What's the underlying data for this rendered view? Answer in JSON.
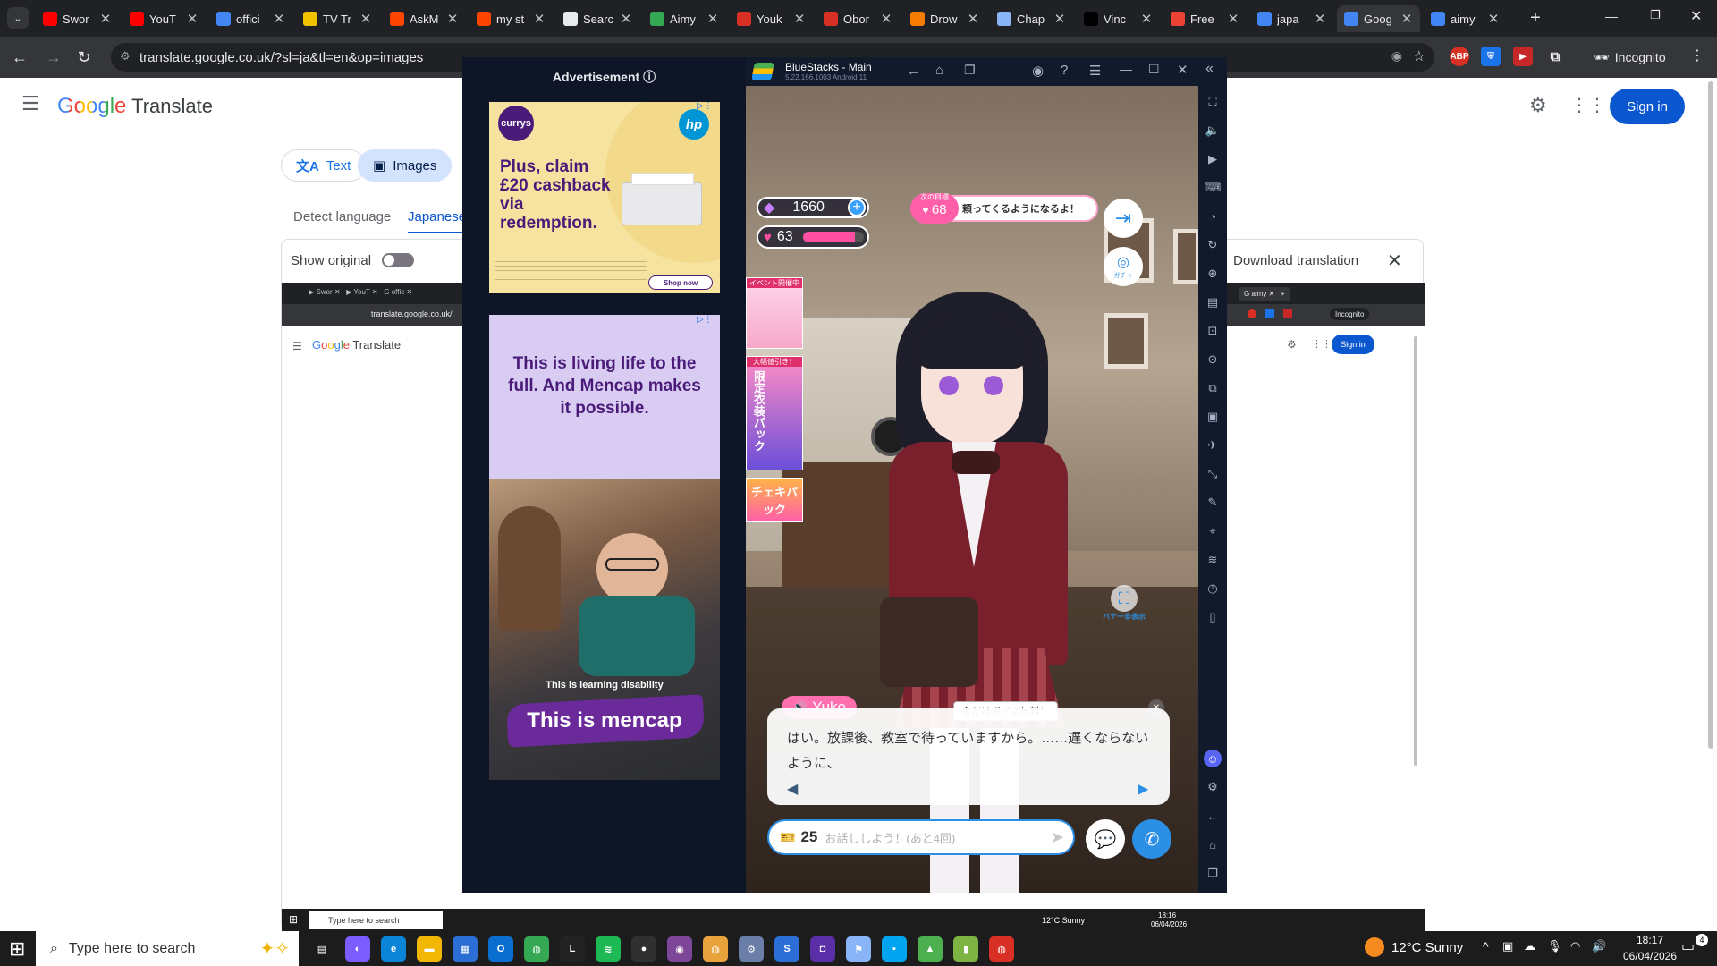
{
  "browser": {
    "tabs": [
      {
        "label": "Swor",
        "fav": "youtube-icon",
        "color": "#ff0000"
      },
      {
        "label": "YouT",
        "fav": "youtube-icon",
        "color": "#ff0000"
      },
      {
        "label": "offici",
        "fav": "google-docs-icon",
        "color": "#4285f4"
      },
      {
        "label": "TV Tr",
        "fav": "tv-tropes-icon",
        "color": "#f2c200"
      },
      {
        "label": "AskM",
        "fav": "reddit-icon",
        "color": "#ff4500"
      },
      {
        "label": "my st",
        "fav": "reddit-icon",
        "color": "#ff4500"
      },
      {
        "label": "Searc",
        "fav": "search-icon",
        "color": "#e8eaed"
      },
      {
        "label": "Aimy",
        "fav": "aimy-icon",
        "color": "#34a853"
      },
      {
        "label": "Youk",
        "fav": "game-site-icon",
        "color": "#d93025"
      },
      {
        "label": "Obor",
        "fav": "game-site-icon",
        "color": "#d93025"
      },
      {
        "label": "Drow",
        "fav": "webtoon-icon",
        "color": "#f57c00"
      },
      {
        "label": "Chap",
        "fav": "chapter-icon",
        "color": "#8ab4f8"
      },
      {
        "label": "Vinc",
        "fav": "vinc-icon",
        "color": "#000000"
      },
      {
        "label": "Free",
        "fav": "gmail-icon",
        "color": "#ea4335"
      },
      {
        "label": "japa",
        "fav": "google-icon",
        "color": "#4285f4"
      },
      {
        "label": "Goog",
        "fav": "google-translate-icon",
        "color": "#4285f4"
      },
      {
        "label": "aimy",
        "fav": "google-icon",
        "color": "#4285f4"
      }
    ],
    "url": "translate.google.co.uk/?sl=ja&tl=en&op=images",
    "incognito_label": "Incognito",
    "ext_abp": "ABP"
  },
  "translate": {
    "logo_google": "Google",
    "logo_translate": "Translate",
    "sign_in": "Sign in",
    "mode_text": "Text",
    "mode_images": "Images",
    "lang_detect": "Detect language",
    "lang_japanese": "Japanese",
    "show_original": "Show original",
    "download": "Download translation"
  },
  "ad": {
    "heading": "Advertisement",
    "currys_brand": "currys",
    "currys_offer": "Plus, claim £20 cashback via redemption.",
    "currys_shop": "Shop now",
    "mencap_headline": "This is living life to the full. And Mencap makes it possible.",
    "mencap_sub": "This is learning disability",
    "mencap_tag": "This is mencap"
  },
  "bluestacks": {
    "title": "BlueStacks - Main",
    "version": "5.22.166.1003  Android 11"
  },
  "game": {
    "gems": "1660",
    "hearts": "63",
    "heart_fill": 0.85,
    "goal_label": "次の目標",
    "goal_value": "68",
    "goal_text": "頼ってくるようになるよ！",
    "gacha_label": "ガチャ",
    "event_banner_1": "イベント開催中",
    "event_banner_2": "大幅値引き！",
    "event_banner_2_text": "限定衣装パック",
    "event_banner_3": "チェキパック",
    "hide_banner": "バナー非表示",
    "speaker_name": "Yuko",
    "voice_free": "今だけボイス無料！",
    "dialogue": "はい。放課後、教室で待っていますから。……遅くならないように、",
    "ticket_count": "25",
    "chat_placeholder": "お話ししよう！(あと4回)"
  },
  "inner_screenshot": {
    "url": "translate.google.co.uk/",
    "logo_translate": "Translate",
    "sign_in": "Sign in",
    "incognito": "Incognito",
    "search": "Type here to search",
    "weather": "12°C  Sunny",
    "time": "18:16",
    "date": "06/04/2026"
  },
  "taskbar": {
    "search": "Type here to search",
    "weather": "12°C  Sunny",
    "time": "18:17",
    "date": "06/04/2026",
    "notif_count": "4"
  }
}
